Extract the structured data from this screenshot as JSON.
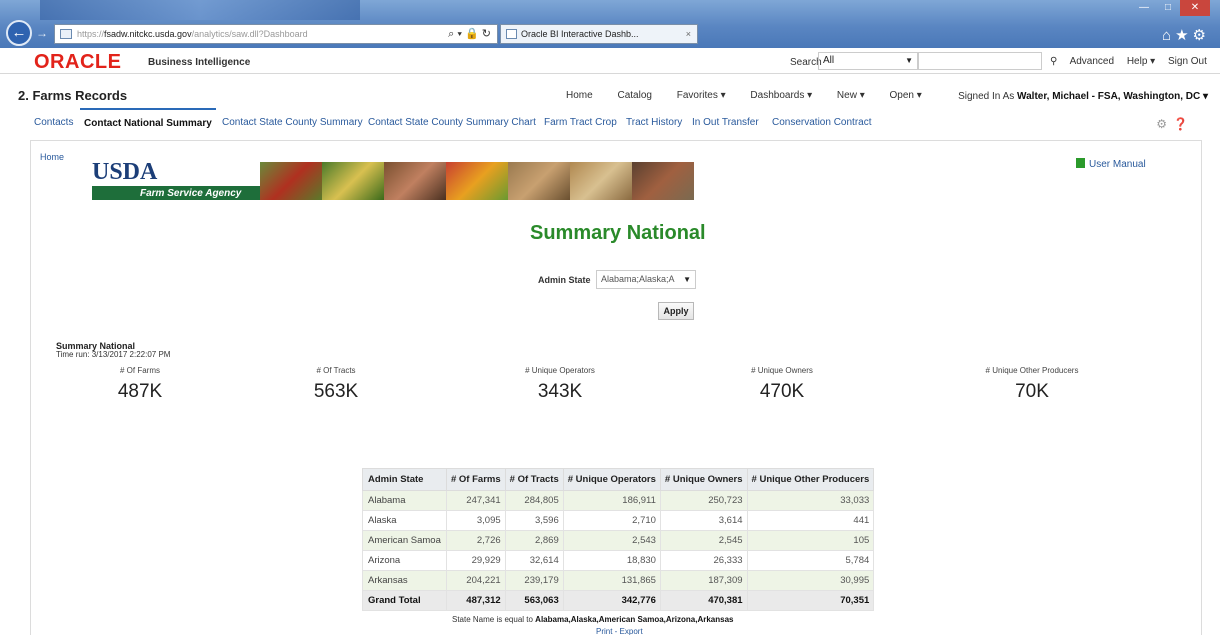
{
  "browser": {
    "url_prefix": "https://",
    "url_host": "fsadw.nitckc.usda.gov",
    "url_path": "/analytics/saw.dll?Dashboard",
    "tab_title": "Oracle BI Interactive Dashb...",
    "tab_close": "×",
    "addr_controls": "⌕ ▾ 🔒 ↻"
  },
  "header": {
    "logo": "ORACLE",
    "product": "Business Intelligence",
    "search_label": "Search",
    "search_scope": "All",
    "links": [
      "Advanced",
      "Help ▾",
      "Sign Out"
    ],
    "more": "•••"
  },
  "dashboard": {
    "title": "2. Farms Records",
    "links": [
      "Home",
      "Catalog",
      "Favorites ▾",
      "Dashboards ▾",
      "New ▾",
      "Open ▾"
    ],
    "signed_in_label": "Signed In As",
    "signed_in_user": "Walter, Michael - FSA, Washington, DC ▾"
  },
  "tabs": [
    "Contacts",
    "Contact National Summary",
    "Contact State County Summary",
    "Contact State County Summary Chart",
    "Farm Tract Crop",
    "Tract History",
    "In Out Transfer",
    "Conservation Contract"
  ],
  "page": {
    "home_link": "Home",
    "usda_logo": "USDA",
    "agency": "Farm Service Agency",
    "user_manual": "User Manual",
    "summary_title": "Summary National",
    "admin_state_label": "Admin State",
    "admin_state_value": "Alabama;Alaska;A",
    "apply": "Apply",
    "section_title": "Summary National",
    "time_run": "Time run: 3/13/2017 2:22:07 PM"
  },
  "kpis": [
    {
      "label": "# Of Farms",
      "value": "487K"
    },
    {
      "label": "# Of Tracts",
      "value": "563K"
    },
    {
      "label": "# Unique Operators",
      "value": "343K"
    },
    {
      "label": "# Unique Owners",
      "value": "470K"
    },
    {
      "label": "# Unique Other Producers",
      "value": "70K"
    }
  ],
  "table": {
    "headers": [
      "Admin State",
      "# Of Farms",
      "# Of Tracts",
      "# Unique Operators",
      "# Unique Owners",
      "# Unique Other Producers"
    ],
    "rows": [
      [
        "Alabama",
        "247,341",
        "284,805",
        "186,911",
        "250,723",
        "33,033"
      ],
      [
        "Alaska",
        "3,095",
        "3,596",
        "2,710",
        "3,614",
        "441"
      ],
      [
        "American Samoa",
        "2,726",
        "2,869",
        "2,543",
        "2,545",
        "105"
      ],
      [
        "Arizona",
        "29,929",
        "32,614",
        "18,830",
        "26,333",
        "5,784"
      ],
      [
        "Arkansas",
        "204,221",
        "239,179",
        "131,865",
        "187,309",
        "30,995"
      ]
    ],
    "total": [
      "Grand Total",
      "487,312",
      "563,063",
      "342,776",
      "470,381",
      "70,351"
    ]
  },
  "footer": {
    "filter_prefix": "State Name is equal to",
    "filter_values": "Alabama,Alaska,American Samoa,Arizona,Arkansas",
    "links": "Print - Export"
  }
}
